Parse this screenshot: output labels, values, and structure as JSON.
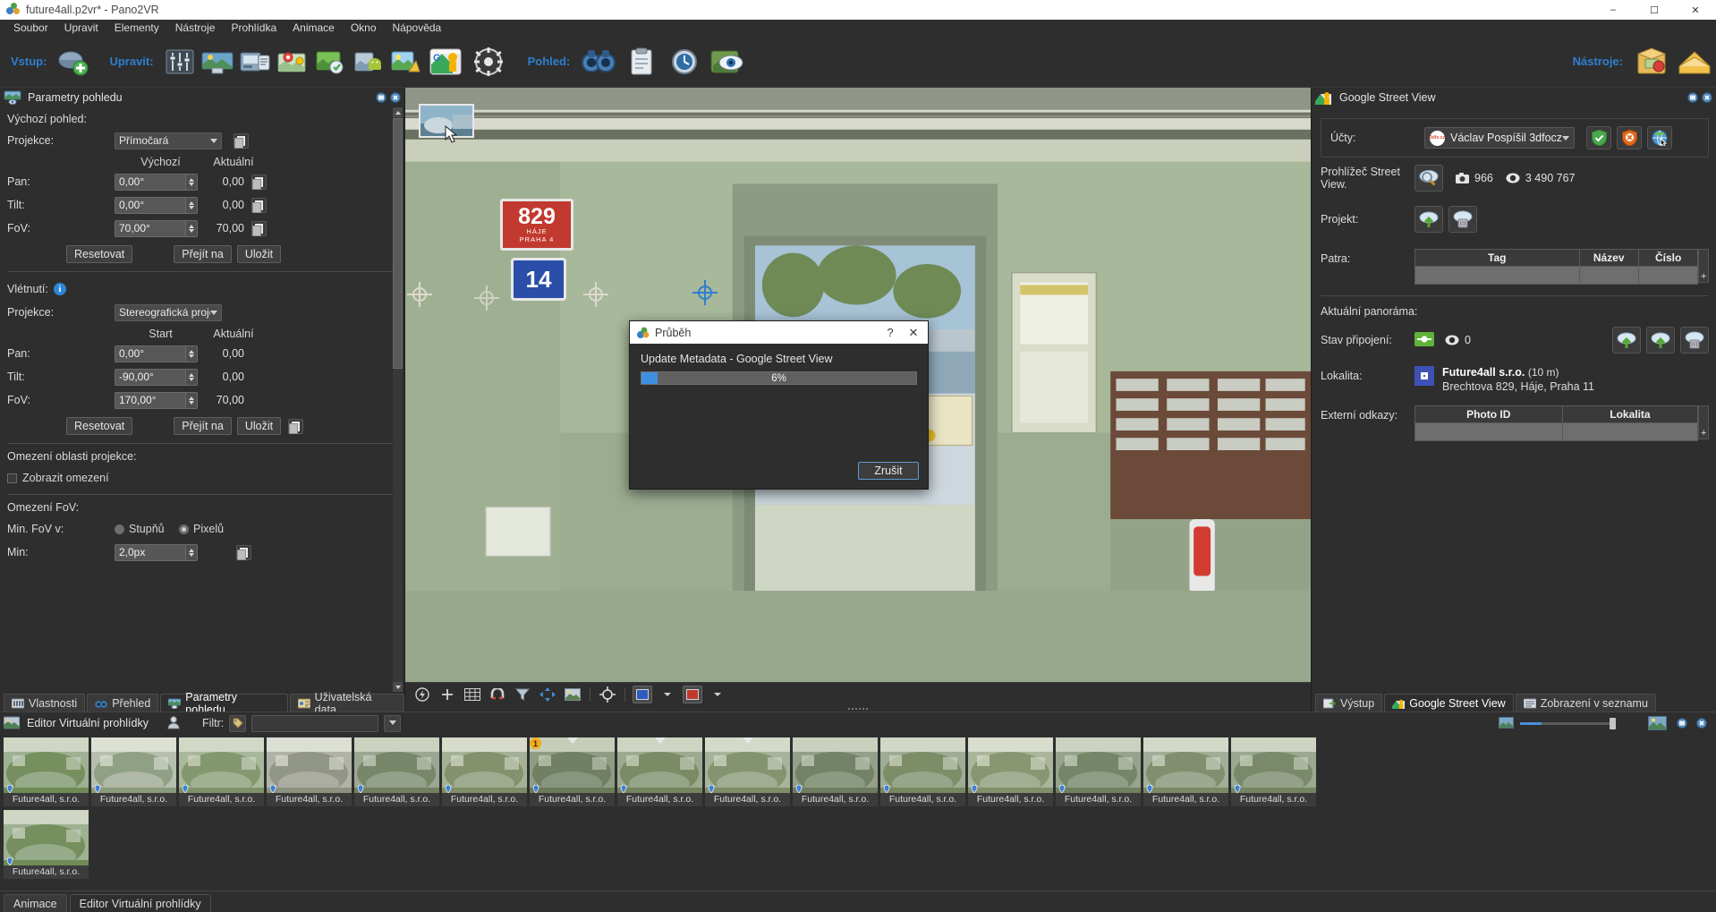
{
  "window": {
    "title": "future4all.p2vr* - Pano2VR",
    "icon": "pano2vr-logo-icon",
    "minimize": "–",
    "maximize": "☐",
    "close": "✕"
  },
  "menu": [
    {
      "label": "Soubor"
    },
    {
      "label": "Upravit"
    },
    {
      "label": "Elementy"
    },
    {
      "label": "Nástroje"
    },
    {
      "label": "Prohlídka"
    },
    {
      "label": "Animace"
    },
    {
      "label": "Okno"
    },
    {
      "label": "Nápověda"
    }
  ],
  "toolbar": {
    "group_input": "Vstup:",
    "group_edit": "Upravit:",
    "group_view": "Pohled:",
    "group_tools": "Nástroje:"
  },
  "left_panel": {
    "title": "Parametry pohledu",
    "default_view_label": "Výchozí pohled:",
    "projection_label": "Projekce:",
    "projection_value": "Přímočará",
    "col_default": "Výchozí",
    "col_current": "Aktuální",
    "pan_label": "Pan:",
    "pan_value": "0,00°",
    "pan_current": "0,00",
    "tilt_label": "Tilt:",
    "tilt_value": "0,00°",
    "tilt_current": "0,00",
    "fov_label": "FoV:",
    "fov_value": "70,00°",
    "fov_current": "70,00",
    "reset_btn": "Resetovat",
    "goto_btn": "Přejít na",
    "save_btn": "Uložit",
    "flyin_label": "Vlétnutí:",
    "flyin_projection_label": "Projekce:",
    "flyin_projection_value": "Stereografická projekce",
    "col_start": "Start",
    "flyin_pan_label": "Pan:",
    "flyin_pan_value": "0,00°",
    "flyin_pan_current": "0,00",
    "flyin_tilt_label": "Tilt:",
    "flyin_tilt_value": "-90,00°",
    "flyin_tilt_current": "0,00",
    "flyin_fov_label": "FoV:",
    "flyin_fov_value": "170,00°",
    "flyin_fov_current": "70,00",
    "limit_area_label": "Omezení oblasti projekce:",
    "show_limit_label": "Zobrazit omezení",
    "fov_limit_label": "Omezení FoV:",
    "min_fov_in_label": "Min. FoV v:",
    "radio_degrees": "Stupňů",
    "radio_pixels": "Pixelů",
    "min_label": "Min:",
    "min_value": "2,0px",
    "tabs": [
      {
        "label": "Vlastnosti",
        "icon": "properties-icon",
        "active": false
      },
      {
        "label": "Přehled",
        "icon": "binoculars-icon",
        "active": false
      },
      {
        "label": "Parametry pohledu",
        "icon": "view-parameters-icon",
        "active": true
      },
      {
        "label": "Uživatelská data",
        "icon": "user-data-icon",
        "active": false
      }
    ]
  },
  "right_panel": {
    "title": "Google Street View",
    "accounts_label": "Účty:",
    "account_name": "Václav Pospíšil 3dfocz",
    "account_avatar": "3dfo.cz",
    "btn_authorize": "shield-check-icon",
    "btn_revoke": "shield-cancel-icon",
    "btn_web": "globe-cursor-icon",
    "viewer_label": "Prohlížeč Street View.",
    "viewer_btn": "cloud-search-icon",
    "photos_count": "966",
    "views_count": "3 490 767",
    "project_label": "Projekt:",
    "project_upload_btn": "cloud-upload-icon",
    "project_delete_btn": "cloud-delete-icon",
    "floors_label": "Patra:",
    "floors_columns": [
      "Tag",
      "Název",
      "Číslo"
    ],
    "floors_rows": [
      [
        "",
        "",
        ""
      ]
    ],
    "add_floor_btn": "+",
    "current_pano_label": "Aktuální panoráma:",
    "connection_label": "Stav připojení:",
    "connection_icon": "connected-plug-icon",
    "connection_views": "0",
    "pano_upload_btn": "cloud-upload-icon",
    "pano_publish_btn": "cloud-arrow-icon",
    "pano_delete_btn": "cloud-delete-icon",
    "location_label": "Lokalita:",
    "location_name": "Future4all s.r.o.",
    "location_distance": "(10 m)",
    "location_address": "Brechtova 829, Háje, Praha 11",
    "external_links_label": "Externí odkazy:",
    "links_columns": [
      "Photo ID",
      "Lokalita"
    ],
    "links_rows": [
      [
        "",
        ""
      ]
    ],
    "add_link_btn": "+",
    "tabs": [
      {
        "label": "Výstup",
        "icon": "output-icon",
        "active": false
      },
      {
        "label": "Google Street View",
        "icon": "street-view-icon",
        "active": true
      },
      {
        "label": "Zobrazení v seznamu",
        "icon": "list-view-icon",
        "active": false
      }
    ]
  },
  "viewer": {
    "sign_829": "829",
    "sign_829_line1": "HÁJE",
    "sign_829_line2": "PRAHA 4",
    "sign_14": "14",
    "toolbar_buttons": [
      {
        "name": "flash-icon"
      },
      {
        "name": "add-point-icon"
      },
      {
        "name": "grid-icon"
      },
      {
        "name": "magnet-icon"
      },
      {
        "name": "filter-icon"
      },
      {
        "name": "move-icon"
      },
      {
        "name": "image-icon"
      },
      {
        "name": "target-icon"
      },
      {
        "name": "blue-swatch-icon"
      },
      {
        "name": "red-swatch-icon"
      }
    ]
  },
  "dialog": {
    "title": "Průběh",
    "icon": "pano2vr-logo-icon",
    "help_btn": "?",
    "close_btn": "✕",
    "message": "Update Metadata - Google Street View",
    "progress_percent": 6,
    "progress_text": "6%",
    "cancel_btn": "Zrušit",
    "accent_color": "#3f8fe0"
  },
  "gallery": {
    "title": "Editor Virtuální prohlídky",
    "user_icon": "user-icon",
    "filter_label": "Filtr:",
    "filter_icon": "tag-icon",
    "filter_value": "",
    "zoom_small_icon": "small-thumbs-icon",
    "zoom_large_icon": "large-thumbs-icon",
    "zoom_value": 24,
    "thumbs_row1": [
      {
        "caption": "Future4all, s.r.o.",
        "badge": "",
        "marker": false
      },
      {
        "caption": "Future4all, s.r.o.",
        "badge": "",
        "marker": false
      },
      {
        "caption": "Future4all, s.r.o.",
        "badge": "",
        "marker": false
      },
      {
        "caption": "Future4all, s.r.o.",
        "badge": "",
        "marker": false
      },
      {
        "caption": "Future4all, s.r.o.",
        "badge": "",
        "marker": false
      },
      {
        "caption": "Future4all, s.r.o.",
        "badge": "",
        "marker": false
      },
      {
        "caption": "Future4all, s.r.o.",
        "badge": "1",
        "marker": true
      },
      {
        "caption": "Future4all, s.r.o.",
        "badge": "",
        "marker": true
      },
      {
        "caption": "Future4all, s.r.o.",
        "badge": "",
        "marker": true
      },
      {
        "caption": "Future4all, s.r.o.",
        "badge": "",
        "marker": false
      },
      {
        "caption": "Future4all, s.r.o.",
        "badge": "",
        "marker": false
      },
      {
        "caption": "Future4all, s.r.o.",
        "badge": "",
        "marker": false
      },
      {
        "caption": "Future4all, s.r.o.",
        "badge": "",
        "marker": false
      },
      {
        "caption": "Future4all, s.r.o.",
        "badge": "",
        "marker": false
      },
      {
        "caption": "Future4all, s.r.o.",
        "badge": "",
        "marker": false
      }
    ],
    "thumbs_row2": [
      {
        "caption": "Future4all, s.r.o.",
        "badge": "",
        "marker": false
      }
    ]
  },
  "statusbar": {
    "tabs": [
      {
        "label": "Animace",
        "active": false
      },
      {
        "label": "Editor Virtuální prohlídky",
        "active": true
      }
    ]
  }
}
